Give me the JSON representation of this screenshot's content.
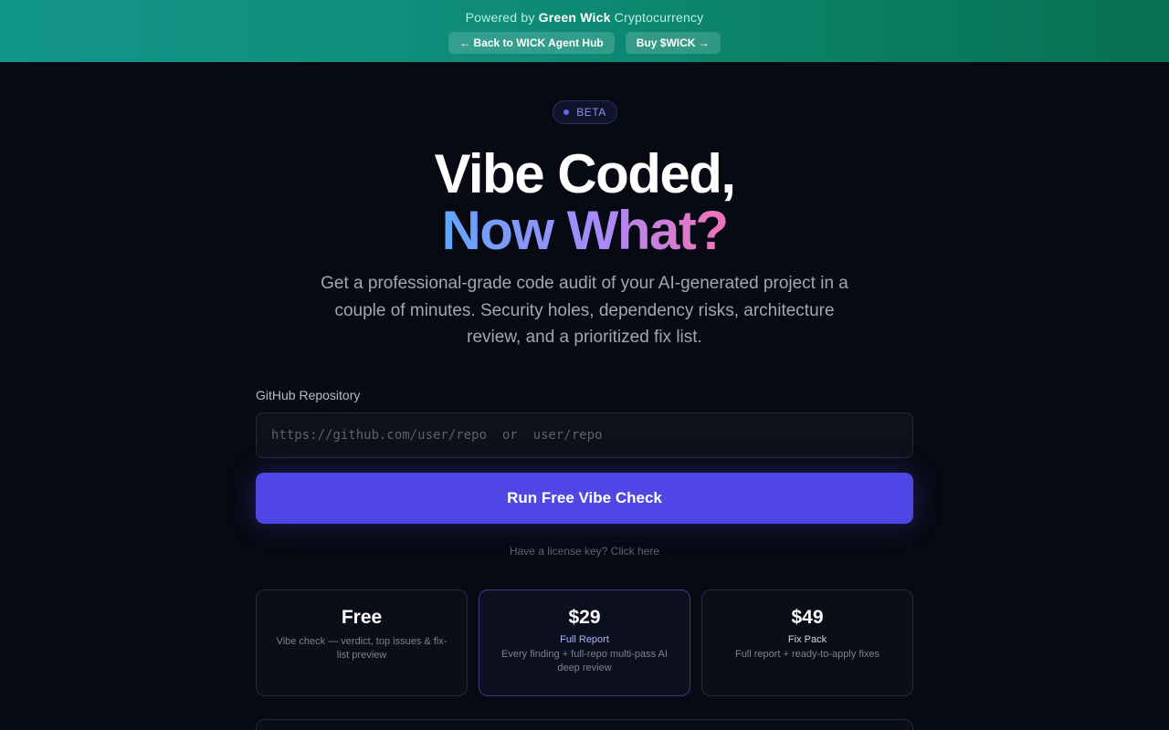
{
  "topbar": {
    "powered_prefix": "Powered by",
    "brand": "Green Wick",
    "powered_suffix": "Cryptocurrency",
    "back_link": "← Back to WICK Agent Hub",
    "buy_link": "Buy $WICK →"
  },
  "hero": {
    "badge": "BETA",
    "headline_line1": "Vibe Coded,",
    "headline_line2": "Now What?",
    "subtitle": "Get a professional-grade code audit of your AI-generated project in a couple of minutes. Security holes, dependency risks, architecture review, and a prioritized fix list."
  },
  "form": {
    "label": "GitHub Repository",
    "placeholder": "https://github.com/user/repo  or  user/repo",
    "value": "",
    "submit_label": "Run Free Vibe Check",
    "license_link": "Have a license key? Click here"
  },
  "plans": [
    {
      "price": "Free",
      "name": "",
      "desc": "Vibe check — verdict, top issues & fix-list preview"
    },
    {
      "price": "$29",
      "name": "Full Report",
      "desc": "Every finding + full-repo multi-pass AI deep review"
    },
    {
      "price": "$49",
      "name": "Fix Pack",
      "desc": "Full report + ready-to-apply fixes"
    }
  ],
  "colors": {
    "topbar_start": "#12968a",
    "topbar_end": "#06704f",
    "accent": "#4f46e5",
    "background": "#070a12",
    "gradient_text": [
      "#60a5fa",
      "#a78bfa",
      "#f472b6"
    ]
  },
  "icons": {
    "badge_dot": "status-dot-icon"
  }
}
